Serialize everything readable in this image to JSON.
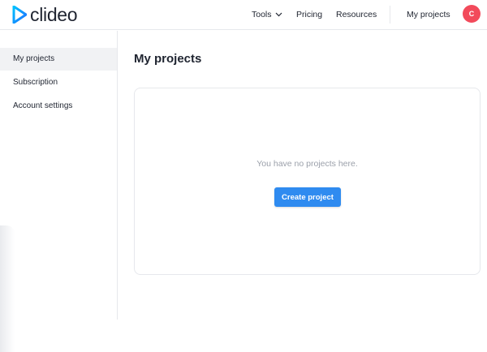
{
  "brand": {
    "name": "clideo"
  },
  "nav": {
    "tools_label": "Tools",
    "pricing_label": "Pricing",
    "resources_label": "Resources",
    "my_projects_label": "My projects"
  },
  "user": {
    "initial": "C",
    "avatar_color": "#f24a5b"
  },
  "sidebar": {
    "items": [
      {
        "label": "My projects",
        "active": true
      },
      {
        "label": "Subscription",
        "active": false
      },
      {
        "label": "Account settings",
        "active": false
      }
    ]
  },
  "main": {
    "title": "My projects",
    "empty_message": "You have no projects here.",
    "create_button_label": "Create project"
  },
  "colors": {
    "accent": "#2f8bf0",
    "logo_gradient_start": "#00c2ff",
    "logo_gradient_end": "#1f6dff"
  }
}
